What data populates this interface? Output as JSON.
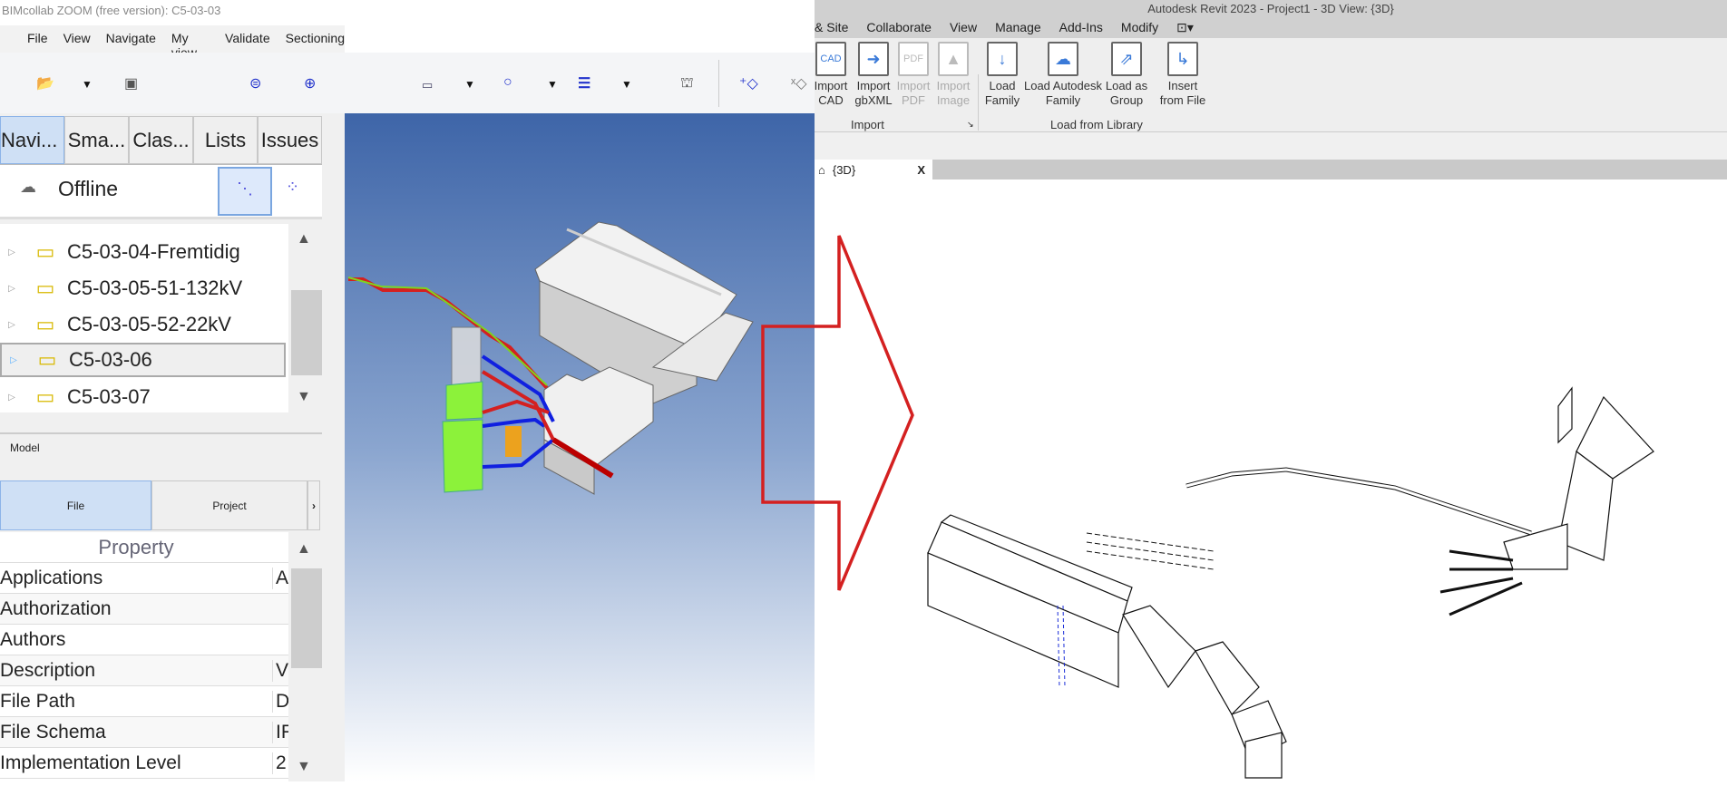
{
  "bim": {
    "title": "BIMcollab ZOOM (free version): C5-03-03",
    "menu": [
      "File",
      "View",
      "Navigate",
      "My view",
      "Validate",
      "Sectioning"
    ],
    "tabs": [
      "Navi...",
      "Sma...",
      "Clas...",
      "Lists",
      "Issues"
    ],
    "status": "Offline",
    "tree": [
      "C5-03-04-Fremtidig",
      "C5-03-05-51-132kV",
      "C5-03-05-52-22kV",
      "C5-03-06",
      "C5-03-07"
    ],
    "model_label": "Model",
    "props_tabs": [
      "File",
      "Project"
    ],
    "props_header": "Property",
    "props": [
      {
        "name": "Applications",
        "value": "A"
      },
      {
        "name": "Authorization",
        "value": ""
      },
      {
        "name": "Authors",
        "value": ""
      },
      {
        "name": "Description",
        "value": "V"
      },
      {
        "name": "File Path",
        "value": "D"
      },
      {
        "name": "File Schema",
        "value": "IF"
      },
      {
        "name": "Implementation Level",
        "value": "2"
      }
    ]
  },
  "revit": {
    "title": "Autodesk Revit 2023 - Project1 - 3D View: {3D}",
    "menu": [
      "& Site",
      "Collaborate",
      "View",
      "Manage",
      "Add-Ins",
      "Modify"
    ],
    "buttons": [
      {
        "l1": "Import",
        "l2": "CAD",
        "icon": "CAD",
        "disabled": false
      },
      {
        "l1": "Import",
        "l2": "gbXML",
        "icon": "➜",
        "disabled": false
      },
      {
        "l1": "Import",
        "l2": "PDF",
        "icon": "PDF",
        "disabled": true
      },
      {
        "l1": "Import",
        "l2": "Image",
        "icon": "▲",
        "disabled": true
      },
      {
        "l1": "Load",
        "l2": "Family",
        "icon": "↓",
        "disabled": false
      },
      {
        "l1": "Load Autodesk",
        "l2": "Family",
        "icon": "☁",
        "disabled": false
      },
      {
        "l1": "Load as",
        "l2": "Group",
        "icon": "⇗",
        "disabled": false
      },
      {
        "l1": "Insert",
        "l2": "from File",
        "icon": "↳",
        "disabled": false
      }
    ],
    "groups": [
      "Import",
      "Load from Library"
    ],
    "view_tab": "{3D}",
    "close": "X"
  },
  "colors": {
    "accent": "#cfe0f5",
    "arrow": "#d42020",
    "viewport_top": "#3e65a8"
  }
}
